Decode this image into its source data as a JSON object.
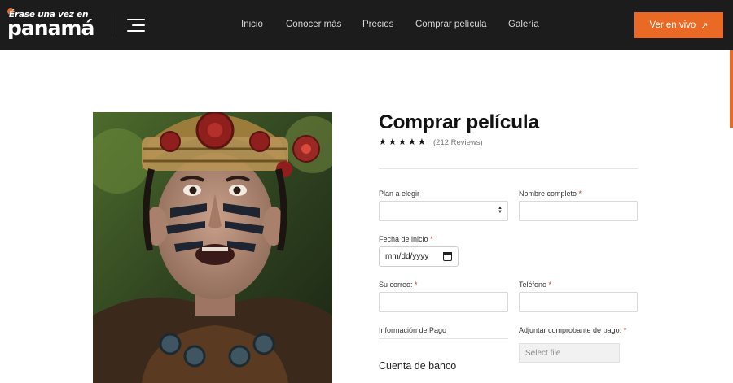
{
  "header": {
    "logo": {
      "top_text": "Érase una vez en",
      "main_text": "panamá"
    },
    "nav": [
      "Inicio",
      "Conocer más",
      "Precios",
      "Comprar película",
      "Galería"
    ],
    "cta": {
      "label": "Ver en vivo",
      "icon": "arrow-up-right-icon"
    },
    "colors": {
      "background": "#1c1c1c",
      "accent": "#ea6a25"
    }
  },
  "product": {
    "title": "Comprar película",
    "rating": {
      "stars": 5,
      "max": 5,
      "reviews_text": "(212 Reviews)"
    }
  },
  "form": {
    "plan": {
      "label": "Plan a elegir",
      "value": ""
    },
    "name": {
      "label": "Nombre completo",
      "required_mark": "*",
      "value": ""
    },
    "start_date": {
      "label": "Fecha de inicio",
      "required_mark": "*",
      "placeholder": "mm/dd/yyyy"
    },
    "email": {
      "label": "Su correo:",
      "required_mark": "*",
      "value": ""
    },
    "phone": {
      "label": "Teléfono",
      "required_mark": "*",
      "value": ""
    },
    "payment_info": {
      "label": "Información de Pago"
    },
    "receipt": {
      "label": "Adjuntar comprobante de pago:",
      "required_mark": "*",
      "button": "Select file"
    },
    "bank_heading": "Cuenta de banco"
  }
}
